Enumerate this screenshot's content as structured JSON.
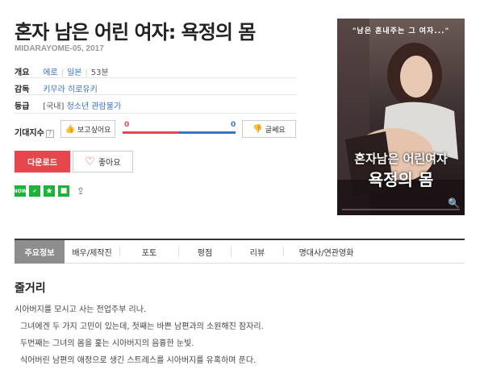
{
  "title": "혼자 남은 어린 여자: 욕정의 몸",
  "subtitle": "MIDARAYOME-05, 2017",
  "info": {
    "genre_label": "개요",
    "genre": "에로",
    "country": "일본",
    "runtime": "53분",
    "director_label": "감독",
    "director": "키무라 히로유키",
    "rating_label": "등급",
    "rating_prefix": "[국내]",
    "rating": "청소년 관람불가"
  },
  "expect": {
    "label": "기대지수",
    "help": "?",
    "want_label": "보고싶어요",
    "want_count": "0",
    "meh_label": "글쎄요",
    "meh_count": "0",
    "want_share": 0.5
  },
  "actions": {
    "download_label": "다운로드",
    "like_label": "좋아요"
  },
  "icon_strip": [
    "now-icon",
    "check-icon",
    "star-icon",
    "square-icon",
    "share-icon"
  ],
  "icon_now_text": "NOW",
  "poster": {
    "tagline": "\"남은 혼내주는 그 여자...\"",
    "title_line1": "혼자남은 어린여자",
    "title_line2": "욕정의 몸"
  },
  "tabs": [
    "주요정보",
    "배우/제작진",
    "포토",
    "평점",
    "리뷰",
    "명대사/연관영화"
  ],
  "synopsis": {
    "heading": "줄거리",
    "lines": [
      "시아버지를 모시고 사는 전업주부 리나.",
      "그녀에겐 두 가지 고민이 있는데, 첫째는 바쁜 남편과의 소원해진 잠자리.",
      "두번째는 그녀의 몸을 훑는 시아버지의 음흉한 눈빛.",
      "식어버린 남편의 애정으로 생긴 스트레스를 시아버지를 유혹하며 푼다."
    ]
  },
  "colors": {
    "accent_red": "#e5474d",
    "link_blue": "#3b73c4",
    "icon_green": "#1db33a",
    "tab_active": "#8d8d8d"
  }
}
